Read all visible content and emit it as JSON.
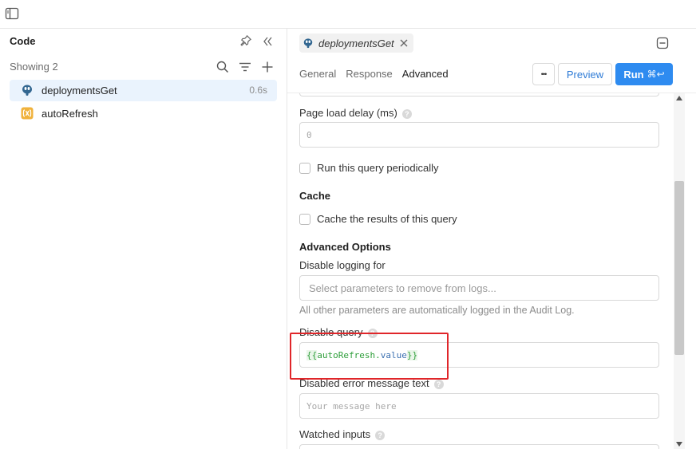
{
  "icons": {
    "panel_toggle": "sidebar-toggle-icon",
    "pin": "pin-icon",
    "collapse": "double-chevron-left-icon",
    "search": "search-icon",
    "filter": "filter-icon",
    "add": "plus-icon"
  },
  "left_panel": {
    "title": "Code",
    "showing": "Showing 2",
    "queries": [
      {
        "name": "deploymentsGet",
        "time": "0.6s",
        "icon": "postgres-icon",
        "selected": true
      },
      {
        "name": "autoRefresh",
        "time": "",
        "icon": "variable-icon",
        "selected": false
      }
    ]
  },
  "editor": {
    "open_tab": "deploymentsGet",
    "tabs": [
      "General",
      "Response",
      "Advanced"
    ],
    "active_tab": "Advanced",
    "more_label": "•••",
    "preview_label": "Preview",
    "run_label": "Run",
    "run_shortcut": "⌘↩",
    "page_load_delay_label": "Page load delay (ms)",
    "page_load_delay_value": "0",
    "run_periodically_label": "Run this query periodically",
    "cache_heading": "Cache",
    "cache_label": "Cache the results of this query",
    "advanced_heading": "Advanced Options",
    "disable_logging_label": "Disable logging for",
    "disable_logging_placeholder": "Select parameters to remove from logs...",
    "audit_hint": "All other parameters are automatically logged in the Audit Log.",
    "disable_query_label": "Disable query",
    "disable_query_open": "{{",
    "disable_query_ident": "autoRefresh",
    "disable_query_dot": ".",
    "disable_query_prop": "value",
    "disable_query_close": "}}",
    "disabled_error_label": "Disabled error message text",
    "disabled_error_placeholder": "Your message here",
    "watched_inputs_label": "Watched inputs",
    "help_glyph": "?"
  },
  "colors": {
    "accent": "#2e8bf0",
    "highlight": "#e0262a",
    "selected_row": "#eaf3fd"
  }
}
